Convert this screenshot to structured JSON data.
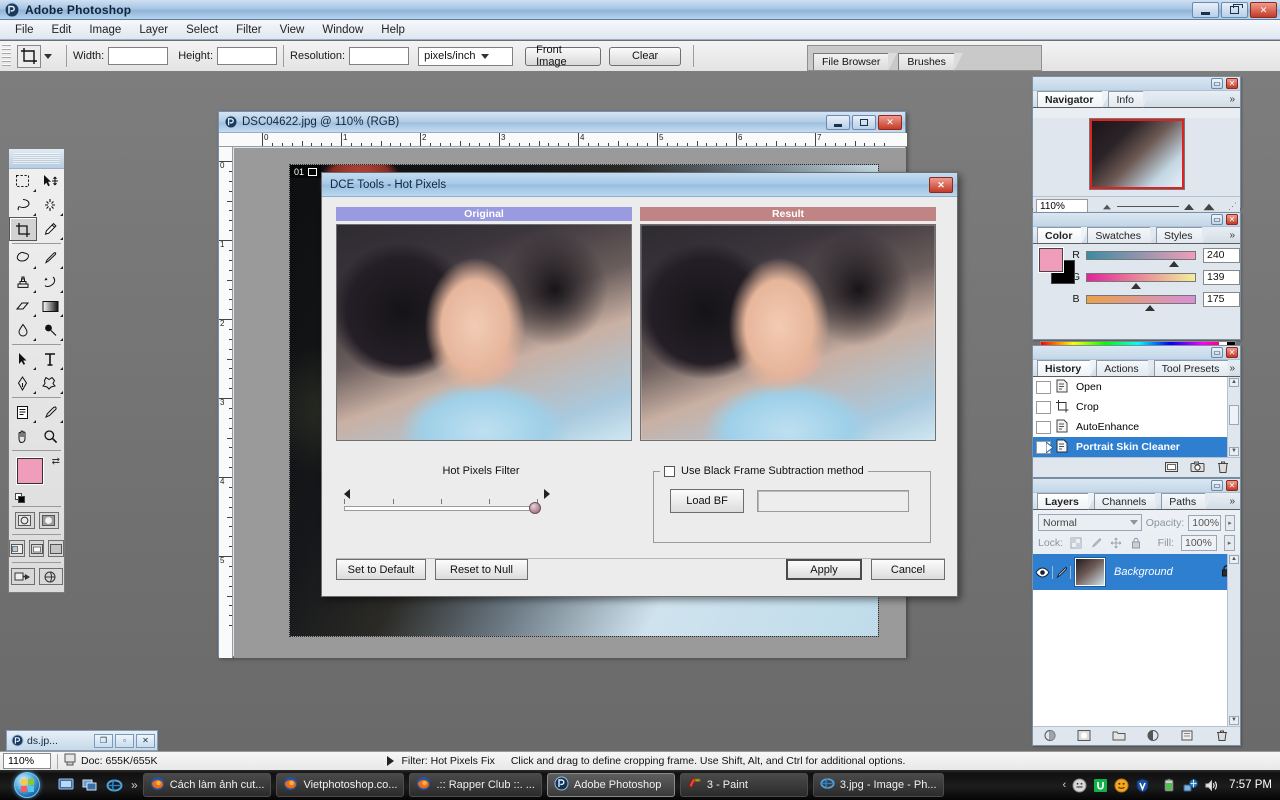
{
  "app": {
    "title": "Adobe Photoshop",
    "icon": "photoshop-icon",
    "window_buttons": {
      "minimize": "minimize-icon",
      "restore": "restore-icon",
      "close": "close-icon"
    }
  },
  "menubar": {
    "items": [
      "File",
      "Edit",
      "Image",
      "Layer",
      "Select",
      "Filter",
      "View",
      "Window",
      "Help"
    ]
  },
  "options_bar": {
    "tool": "crop-tool",
    "width_label": "Width:",
    "width_value": "",
    "height_label": "Height:",
    "height_value": "",
    "resolution_label": "Resolution:",
    "resolution_value": "",
    "units": "pixels/inch",
    "front_image_label": "Front Image",
    "clear_label": "Clear"
  },
  "palette_well": {
    "tabs": [
      "File Browser",
      "Brushes"
    ]
  },
  "toolbox": {
    "tools": [
      "marquee-tool",
      "move-tool",
      "lasso-tool",
      "magic-wand-tool",
      "crop-tool",
      "slice-tool",
      "healing-brush-tool",
      "brush-tool",
      "clone-stamp-tool",
      "history-brush-tool",
      "eraser-tool",
      "gradient-tool",
      "blur-tool",
      "dodge-tool",
      "path-selection-tool",
      "type-tool",
      "pen-tool",
      "shape-tool",
      "notes-tool",
      "eyedropper-tool",
      "hand-tool",
      "zoom-tool"
    ],
    "selected_tool": "crop-tool",
    "foreground_color": "#f09dbb",
    "background_color": "#000000"
  },
  "document": {
    "title": "DSC04622.jpg @ 110% (RGB)",
    "ruler_h_labels": [
      "0",
      "1",
      "2",
      "3",
      "4",
      "5",
      "6",
      "7"
    ],
    "ruler_v_labels": [
      "0",
      "1",
      "2",
      "3",
      "4",
      "5"
    ],
    "canvas_tag": "01"
  },
  "dialog": {
    "title": "DCE Tools - Hot Pixels",
    "close_label": "✕",
    "preview_original_label": "Original",
    "preview_result_label": "Result",
    "slider_label": "Hot Pixels Filter",
    "slider_value": 100,
    "slider_min": 0,
    "slider_max": 100,
    "checkbox_label": "Use Black Frame Subtraction method",
    "checkbox_checked": false,
    "load_bf_label": "Load BF",
    "bf_path_value": "",
    "set_default_label": "Set to Default",
    "reset_null_label": "Reset to Null",
    "apply_label": "Apply",
    "cancel_label": "Cancel",
    "colors": {
      "original_header": "#9a9ae0",
      "result_header": "#c08484"
    }
  },
  "panels": {
    "navigator": {
      "tabs": [
        "Navigator",
        "Info"
      ],
      "active_tab": "Navigator",
      "zoom_value": "110%",
      "more_icon": "chevron-double-right-icon"
    },
    "color": {
      "tabs": [
        "Color",
        "Swatches",
        "Styles"
      ],
      "active_tab": "Color",
      "channels": [
        {
          "label": "R",
          "value": "240"
        },
        {
          "label": "G",
          "value": "139"
        },
        {
          "label": "B",
          "value": "175"
        }
      ],
      "foreground": "#f09dbb",
      "background": "#000000"
    },
    "history": {
      "tabs": [
        "History",
        "Actions",
        "Tool Presets"
      ],
      "active_tab": "History",
      "items": [
        {
          "label": "Open",
          "icon": "document-icon",
          "selected": false
        },
        {
          "label": "Crop",
          "icon": "crop-icon",
          "selected": false
        },
        {
          "label": "AutoEnhance",
          "icon": "document-icon",
          "selected": false
        },
        {
          "label": "Portrait Skin Cleaner",
          "icon": "document-icon",
          "selected": true
        }
      ],
      "footer_icons": [
        "new-document-icon",
        "new-snapshot-icon",
        "delete-icon"
      ]
    },
    "layers": {
      "tabs": [
        "Layers",
        "Channels",
        "Paths"
      ],
      "active_tab": "Layers",
      "blend_mode": "Normal",
      "opacity_label": "Opacity:",
      "opacity_value": "100%",
      "lock_label": "Lock:",
      "fill_label": "Fill:",
      "fill_value": "100%",
      "items": [
        {
          "name": "Background",
          "visible": true,
          "locked": true,
          "selected": true
        }
      ]
    }
  },
  "status_bar": {
    "zoom": "110%",
    "doc_info": "Doc: 655K/655K",
    "filter_info": "Filter: Hot Pixels Fix",
    "hint": "Click and drag to define cropping frame. Use Shift, Alt, and Ctrl for additional options."
  },
  "minimized_document": {
    "title": "ds.jp...",
    "buttons": [
      "restore-icon",
      "minimize-icon",
      "close-icon"
    ]
  },
  "taskbar": {
    "start_label": "start-orb",
    "quick_launch": [
      "show-desktop-icon",
      "switch-windows-icon",
      "internet-explorer-icon"
    ],
    "items": [
      {
        "label": "Cách làm ảnh cut...",
        "icon": "firefox-icon",
        "active": false
      },
      {
        "label": "Vietphotoshop.co...",
        "icon": "firefox-icon",
        "active": false
      },
      {
        "label": ".:: Rapper Club ::. ...",
        "icon": "firefox-icon",
        "active": false
      },
      {
        "label": "Adobe Photoshop",
        "icon": "photoshop-icon",
        "active": true
      },
      {
        "label": "3 - Paint",
        "icon": "paint-icon",
        "active": false
      },
      {
        "label": "3.jpg - Image - Ph...",
        "icon": "internet-explorer-icon",
        "active": false
      }
    ],
    "tray_icons": [
      "chevron-left-icon",
      "messenger-icon",
      "unikey-icon",
      "yahoo-icon",
      "antivirus-icon",
      "battery-icon",
      "network-icon",
      "volume-icon"
    ],
    "clock": "7:57 PM"
  }
}
